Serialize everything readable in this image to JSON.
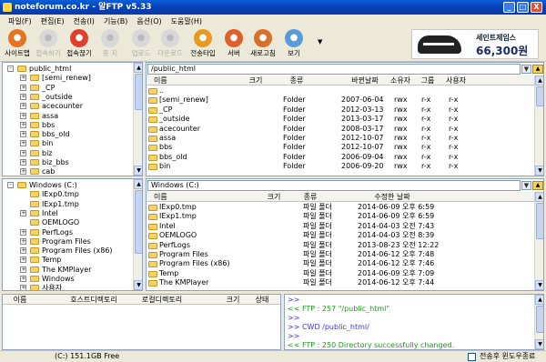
{
  "window": {
    "title": "noteforum.co.kr - 알FTP v5.33",
    "buttons": [
      "_",
      "□",
      "X"
    ]
  },
  "menu": [
    "파일(F)",
    "편집(E)",
    "전송(I)",
    "기능(B)",
    "옵션(O)",
    "도움말(H)"
  ],
  "toolbar": [
    {
      "label": "사이트맵",
      "icon": "sitemap-icon",
      "color": "#e8731e",
      "enabled": true
    },
    {
      "label": "접속하기",
      "icon": "connect-icon",
      "color": "#e8731e",
      "enabled": false
    },
    {
      "label": "접속끊기",
      "icon": "disconnect-icon",
      "color": "#e0402a",
      "enabled": true
    },
    {
      "label": "중 지",
      "icon": "stop-icon",
      "color": "#c0c0c0",
      "enabled": false
    },
    {
      "label": "업로드",
      "icon": "upload-icon",
      "color": "#c0c0c0",
      "enabled": false
    },
    {
      "label": "다운로드",
      "icon": "download-icon",
      "color": "#c0c0c0",
      "enabled": false
    },
    {
      "label": "전송타입",
      "icon": "transfer-type-icon",
      "color": "#e89a1e",
      "enabled": true
    },
    {
      "label": "서버",
      "icon": "server-icon",
      "color": "#e0602a",
      "enabled": true
    },
    {
      "label": "새로고침",
      "icon": "refresh-icon",
      "color": "#d8702a",
      "enabled": true
    },
    {
      "label": "보기",
      "icon": "view-icon",
      "color": "#5a9ad8",
      "enabled": true
    }
  ],
  "ad": {
    "brand": "세인트제임스",
    "price": "66,300원"
  },
  "remote": {
    "path": "/public_html",
    "tree": [
      {
        "label": "public_html",
        "level": 0,
        "sign": "-"
      },
      {
        "label": "[semi_renew]",
        "level": 1,
        "sign": "+"
      },
      {
        "label": "_CP",
        "level": 1,
        "sign": "+"
      },
      {
        "label": "_outside",
        "level": 1,
        "sign": "+"
      },
      {
        "label": "acecounter",
        "level": 1,
        "sign": "+"
      },
      {
        "label": "assa",
        "level": 1,
        "sign": "+"
      },
      {
        "label": "bbs",
        "level": 1,
        "sign": "+"
      },
      {
        "label": "bbs_old",
        "level": 1,
        "sign": "+"
      },
      {
        "label": "bin",
        "level": 1,
        "sign": "+"
      },
      {
        "label": "biz",
        "level": 1,
        "sign": "+"
      },
      {
        "label": "biz_bbs",
        "level": 1,
        "sign": "+"
      },
      {
        "label": "cab",
        "level": 1,
        "sign": "+"
      }
    ],
    "columns": [
      "이름",
      "크기",
      "종류",
      "바뀐날짜",
      "소유자",
      "그룹",
      "사용자"
    ],
    "files": [
      {
        "name": "..",
        "size": "",
        "type": "",
        "date": "",
        "owner": "",
        "group": "",
        "user": ""
      },
      {
        "name": "[semi_renew]",
        "size": "",
        "type": "Folder",
        "date": "2007-06-04",
        "owner": "rwx",
        "group": "r-x",
        "user": "r-x"
      },
      {
        "name": "_CP",
        "size": "",
        "type": "Folder",
        "date": "2012-03-13",
        "owner": "rwx",
        "group": "r-x",
        "user": "r-x"
      },
      {
        "name": "_outside",
        "size": "",
        "type": "Folder",
        "date": "2013-03-17",
        "owner": "rwx",
        "group": "r-x",
        "user": "r-x"
      },
      {
        "name": "acecounter",
        "size": "",
        "type": "Folder",
        "date": "2008-03-17",
        "owner": "rwx",
        "group": "r-x",
        "user": "r-x"
      },
      {
        "name": "assa",
        "size": "",
        "type": "Folder",
        "date": "2012-10-07",
        "owner": "rwx",
        "group": "r-x",
        "user": "r-x"
      },
      {
        "name": "bbs",
        "size": "",
        "type": "Folder",
        "date": "2012-10-07",
        "owner": "rwx",
        "group": "r-x",
        "user": "r-x"
      },
      {
        "name": "bbs_old",
        "size": "",
        "type": "Folder",
        "date": "2006-09-04",
        "owner": "rwx",
        "group": "r-x",
        "user": "r-x"
      },
      {
        "name": "bin",
        "size": "",
        "type": "Folder",
        "date": "2006-09-20",
        "owner": "rwx",
        "group": "r-x",
        "user": "r-x"
      }
    ]
  },
  "local": {
    "path": "Windows (C:)",
    "tree": [
      {
        "label": "Windows (C:)",
        "level": 0,
        "sign": "-"
      },
      {
        "label": "IExp0.tmp",
        "level": 1,
        "sign": ""
      },
      {
        "label": "IExp1.tmp",
        "level": 1,
        "sign": ""
      },
      {
        "label": "Intel",
        "level": 1,
        "sign": "+"
      },
      {
        "label": "OEMLOGO",
        "level": 1,
        "sign": ""
      },
      {
        "label": "PerfLogs",
        "level": 1,
        "sign": "+"
      },
      {
        "label": "Program Files",
        "level": 1,
        "sign": "+"
      },
      {
        "label": "Program Files (x86)",
        "level": 1,
        "sign": "+"
      },
      {
        "label": "Temp",
        "level": 1,
        "sign": "+"
      },
      {
        "label": "The KMPlayer",
        "level": 1,
        "sign": "+"
      },
      {
        "label": "Windows",
        "level": 1,
        "sign": "+"
      },
      {
        "label": "사용자",
        "level": 1,
        "sign": "+"
      }
    ],
    "columns": [
      "이름",
      "크기",
      "종류",
      "수정한 날짜"
    ],
    "files": [
      {
        "name": "IExp0.tmp",
        "size": "",
        "type": "파일 폴더",
        "date": "2014-06-09 오후 6:59"
      },
      {
        "name": "IExp1.tmp",
        "size": "",
        "type": "파일 폴더",
        "date": "2014-06-09 오후 6:59"
      },
      {
        "name": "Intel",
        "size": "",
        "type": "파일 폴더",
        "date": "2014-04-03 오전 7:43"
      },
      {
        "name": "OEMLOGO",
        "size": "",
        "type": "파일 폴더",
        "date": "2014-04-03 오전 8:39"
      },
      {
        "name": "PerfLogs",
        "size": "",
        "type": "파일 폴더",
        "date": "2013-08-23 오전 12:22"
      },
      {
        "name": "Program Files",
        "size": "",
        "type": "파일 폴더",
        "date": "2014-06-12 오후 7:48"
      },
      {
        "name": "Program Files (x86)",
        "size": "",
        "type": "파일 폴더",
        "date": "2014-06-12 오후 7:46"
      },
      {
        "name": "Temp",
        "size": "",
        "type": "파일 폴더",
        "date": "2014-06-09 오후 7:09"
      },
      {
        "name": "The KMPlayer",
        "size": "",
        "type": "파일 폴더",
        "date": "2014-06-12 오후 7:44"
      }
    ]
  },
  "queue": {
    "columns": [
      "이름",
      "호스트디렉토리",
      "로컬디렉토리",
      "크기",
      "상태"
    ]
  },
  "log": [
    {
      "text": ">>",
      "color": "#3a3ad8"
    },
    {
      "text": "<< FTP : 257 \"/public_html\"",
      "color": "#1a9a1a"
    },
    {
      "text": ">>",
      "color": "#3a3ad8"
    },
    {
      "text": ">> CWD /public_html/",
      "color": "#3a3ad8"
    },
    {
      "text": ">>",
      "color": "#3a3ad8"
    },
    {
      "text": "<< FTP : 250 Directory successfully changed.",
      "color": "#1a9a1a"
    }
  ],
  "status": {
    "drive": "(C:) 151.1GB Free",
    "checkbox_label": "전송후 윈도우종료"
  }
}
